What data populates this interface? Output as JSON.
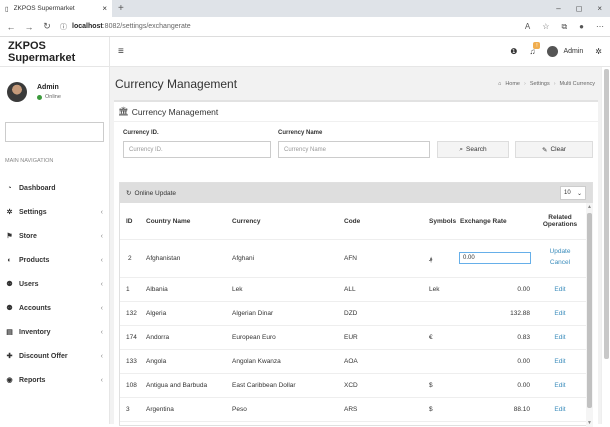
{
  "browser": {
    "tab_title": "ZKPOS Supermarket",
    "tab_close": "×",
    "new_tab": "+",
    "url_host": "localhost",
    "url_path": ":8082/settings/exchangerate",
    "minimize": "–",
    "maximize": "◻",
    "close": "×"
  },
  "app": {
    "logo": "ZKPOS Supermarket",
    "hamburger": "≡",
    "user_label": "Admin",
    "notification_count": "!"
  },
  "sidebar": {
    "user_name": "Admin",
    "status": "Online",
    "nav_label": "MAIN NAVIGATION",
    "items": [
      {
        "label": "Dashboard",
        "icon": "dashboard-icon",
        "glyph": "◔",
        "chev": ""
      },
      {
        "label": "Settings",
        "icon": "gear-icon",
        "glyph": "✲",
        "chev": "‹"
      },
      {
        "label": "Store",
        "icon": "store-icon",
        "glyph": "⚑",
        "chev": "‹"
      },
      {
        "label": "Products",
        "icon": "products-icon",
        "glyph": "◐",
        "chev": "‹"
      },
      {
        "label": "Users",
        "icon": "users-icon",
        "glyph": "⚉",
        "chev": "‹"
      },
      {
        "label": "Accounts",
        "icon": "accounts-icon",
        "glyph": "⚉",
        "chev": "‹"
      },
      {
        "label": "Inventory",
        "icon": "inventory-icon",
        "glyph": "▤",
        "chev": "‹"
      },
      {
        "label": "Discount Offer",
        "icon": "plus-icon",
        "glyph": "✚",
        "chev": "‹"
      },
      {
        "label": "Reports",
        "icon": "reports-icon",
        "glyph": "◉",
        "chev": "‹"
      }
    ]
  },
  "page": {
    "title": "Currency Management",
    "breadcrumb": [
      "Home",
      "Settings",
      "Multi Currency"
    ],
    "box_title": "Currency Management"
  },
  "filter": {
    "currency_id_label": "Currency ID.",
    "currency_id_placeholder": "Currency ID.",
    "currency_name_label": "Currency Name",
    "currency_name_placeholder": "Currency Name",
    "search_label": "Search",
    "clear_label": "Clear"
  },
  "table": {
    "online_update": "Online Update",
    "page_size": "10",
    "headers": {
      "id": "ID",
      "country": "Country Name",
      "currency": "Currency",
      "code": "Code",
      "symbols": "Symbols",
      "rate": "Exchange Rate",
      "ops": "Related Operations"
    },
    "editing_row": {
      "id": "2",
      "country": "Afghanistan",
      "currency": "Afghani",
      "code": "AFN",
      "symbol": "؋",
      "rate": "0.00",
      "update": "Update",
      "cancel": "Cancel"
    },
    "rows": [
      {
        "id": "1",
        "country": "Albania",
        "currency": "Lek",
        "code": "ALL",
        "symbol": "Lek",
        "rate": "0.00",
        "op": "Edit"
      },
      {
        "id": "132",
        "country": "Algeria",
        "currency": "Algerian Dinar",
        "code": "DZD",
        "symbol": "",
        "rate": "132.88",
        "op": "Edit"
      },
      {
        "id": "174",
        "country": "Andorra",
        "currency": "European Euro",
        "code": "EUR",
        "symbol": "€",
        "rate": "0.83",
        "op": "Edit"
      },
      {
        "id": "133",
        "country": "Angola",
        "currency": "Angolan Kwanza",
        "code": "AOA",
        "symbol": "",
        "rate": "0.00",
        "op": "Edit"
      },
      {
        "id": "108",
        "country": "Antigua and Barbuda",
        "currency": "East Caribbean Dollar",
        "code": "XCD",
        "symbol": "$",
        "rate": "0.00",
        "op": "Edit"
      },
      {
        "id": "3",
        "country": "Argentina",
        "currency": "Peso",
        "code": "ARS",
        "symbol": "$",
        "rate": "88.10",
        "op": "Edit"
      }
    ]
  }
}
